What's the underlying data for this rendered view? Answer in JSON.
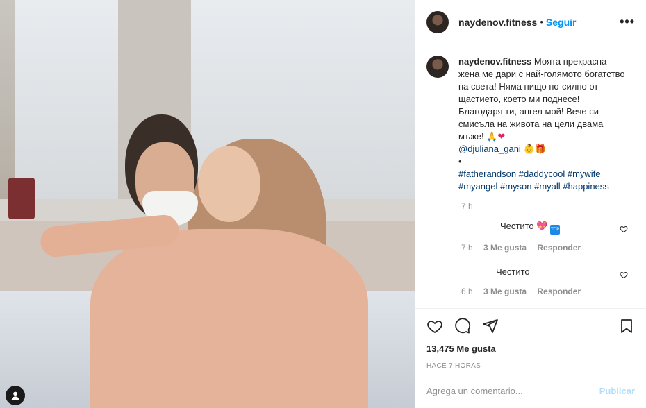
{
  "post": {
    "username": "naydenov.fitness",
    "separator": "•",
    "follow_label": "Seguir",
    "more_label": "•••"
  },
  "caption": {
    "username": "naydenov.fitness",
    "text": "Моята прекрасна жена ме дари с най-голямото богатство на света! Няма нищо по-силно от щастието, което ми поднесе! Благодаря ти, ангел мой! Вече си смисъла на живота на цели двама мъже!",
    "mention": "@djuliana_gani",
    "bullet": "•",
    "hashtags_line1": "#fatherandson #daddycool #mywife",
    "hashtags_line2": "#myangel #myson #myall #happiness",
    "time": "7 h"
  },
  "replies": [
    {
      "text": "Честито",
      "time": "7 h",
      "likes": "3 Me gusta",
      "reply_label": "Responder"
    },
    {
      "text": "Честито",
      "time": "6 h",
      "likes": "3 Me gusta",
      "reply_label": "Responder"
    }
  ],
  "likes": {
    "count": "13,475",
    "label": "Me gusta"
  },
  "posted_ago": "HACE 7 HORAS",
  "comment_box": {
    "placeholder": "Agrega un comentario...",
    "publish_label": "Publicar"
  }
}
